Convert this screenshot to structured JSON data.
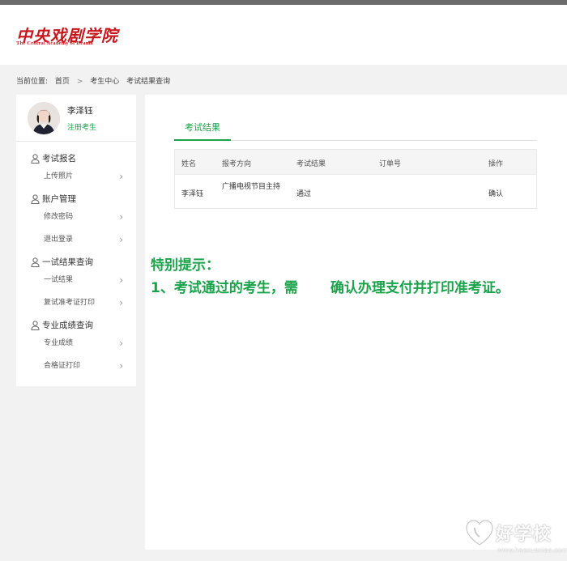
{
  "site": {
    "logo_cn": "中央戏剧学院",
    "logo_en": "The Central Academy of Drama"
  },
  "breadcrumb": {
    "prefix": "当前位置:",
    "home": "首页",
    "sep": ">",
    "center": "考生中心",
    "current": "考试结果查询"
  },
  "profile": {
    "name": "李泽钰",
    "tag": "注册考生"
  },
  "sidebar": {
    "sections": [
      {
        "label": "考试报名",
        "items": [
          "上传照片"
        ]
      },
      {
        "label": "账户管理",
        "items": [
          "修改密码",
          "退出登录"
        ]
      },
      {
        "label": "一试结果查询",
        "items": [
          "一试结果",
          "复试准考证打印"
        ]
      },
      {
        "label": "专业成绩查询",
        "items": [
          "专业成绩",
          "合格证打印"
        ]
      }
    ],
    "chevron": "›"
  },
  "main": {
    "tab": "考试结果",
    "table": {
      "headers": [
        "姓名",
        "报考方向",
        "考试结果",
        "订单号",
        "操作"
      ],
      "rows": [
        {
          "name": "李泽钰",
          "direction": "广播电视节目主持",
          "result": "通过",
          "order": "",
          "action": "确认"
        }
      ]
    }
  },
  "notice": {
    "title": "特别提示：",
    "line_start": "1、考试通过的考生，需",
    "line_end": "确认办理支付并打印准考证。"
  },
  "watermark": {
    "text": "好学校",
    "url": "www.haoxuexiao.com"
  },
  "colors": {
    "accent": "#1aa34a",
    "brand_red": "#c8161d"
  }
}
